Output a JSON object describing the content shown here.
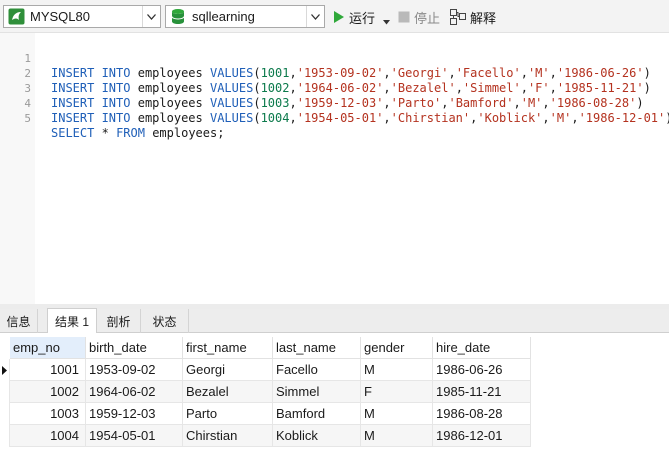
{
  "toolbar": {
    "connection": "MYSQL80",
    "database": "sqllearning",
    "run_label": "运行",
    "stop_label": "停止",
    "explain_label": "解释"
  },
  "editor": {
    "lines": [
      {
        "no": "1",
        "kw1": "INSERT INTO",
        "table": "employees",
        "kw2": "VALUES",
        "id": "1001",
        "birth": "'1953-09-02'",
        "first": "'Georgi'",
        "last": "'Facello'",
        "gender": "'M'",
        "hire": "'1986-06-26'"
      },
      {
        "no": "2",
        "kw1": "INSERT INTO",
        "table": "employees",
        "kw2": "VALUES",
        "id": "1002",
        "birth": "'1964-06-02'",
        "first": "'Bezalel'",
        "last": "'Simmel'",
        "gender": "'F'",
        "hire": "'1985-11-21'"
      },
      {
        "no": "3",
        "kw1": "INSERT INTO",
        "table": "employees",
        "kw2": "VALUES",
        "id": "1003",
        "birth": "'1959-12-03'",
        "first": "'Parto'",
        "last": "'Bamford'",
        "gender": "'M'",
        "hire": "'1986-08-28'"
      },
      {
        "no": "4",
        "kw1": "INSERT INTO",
        "table": "employees",
        "kw2": "VALUES",
        "id": "1004",
        "birth": "'1954-05-01'",
        "first": "'Chirstian'",
        "last": "'Koblick'",
        "gender": "'M'",
        "hire": "'1986-12-01'"
      }
    ],
    "select_line": {
      "no": "5",
      "kw1": "SELECT",
      "star": "*",
      "kw2": "FROM",
      "table": "employees;"
    }
  },
  "tabs": {
    "info": "信息",
    "result": "结果 1",
    "profile": "剖析",
    "status": "状态"
  },
  "grid": {
    "columns": [
      "emp_no",
      "birth_date",
      "first_name",
      "last_name",
      "gender",
      "hire_date"
    ],
    "rows": [
      [
        "1001",
        "1953-09-02",
        "Georgi",
        "Facello",
        "M",
        "1986-06-26"
      ],
      [
        "1002",
        "1964-06-02",
        "Bezalel",
        "Simmel",
        "F",
        "1985-11-21"
      ],
      [
        "1003",
        "1959-12-03",
        "Parto",
        "Bamford",
        "M",
        "1986-08-28"
      ],
      [
        "1004",
        "1954-05-01",
        "Chirstian",
        "Koblick",
        "M",
        "1986-12-01"
      ]
    ]
  },
  "colors": {
    "keyword": "#1f5fb8",
    "number": "#0c7a4c",
    "string": "#b4321f",
    "run_icon": "#2fa83a",
    "db_icon": "#2fa83a"
  },
  "icons": {
    "connection": "mysql-dolphin-icon",
    "database": "database-icon",
    "run": "play-icon",
    "stop": "stop-icon",
    "explain": "explain-icon",
    "row_pointer": "row-pointer-icon"
  }
}
